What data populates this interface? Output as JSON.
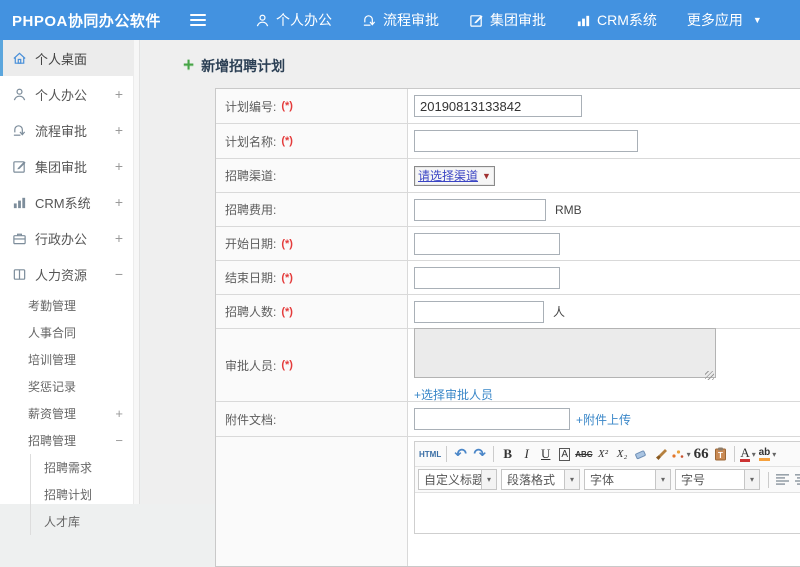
{
  "brand": "PHPOA协同办公软件",
  "icons": {
    "caret_down": "▼",
    "caret_small": "▾"
  },
  "topnav": {
    "items": [
      {
        "label": "个人办公"
      },
      {
        "label": "流程审批"
      },
      {
        "label": "集团审批"
      },
      {
        "label": "CRM系统"
      },
      {
        "label": "更多应用"
      }
    ]
  },
  "sidebar": {
    "items": [
      {
        "label": "个人桌面",
        "expand": ""
      },
      {
        "label": "个人办公",
        "expand": "+"
      },
      {
        "label": "流程审批",
        "expand": "+"
      },
      {
        "label": "集团审批",
        "expand": "+"
      },
      {
        "label": "CRM系统",
        "expand": "+"
      },
      {
        "label": "行政办公",
        "expand": "+"
      },
      {
        "label": "人力资源",
        "expand": "−"
      }
    ],
    "sub_items": [
      {
        "label": "考勤管理",
        "expand": ""
      },
      {
        "label": "人事合同",
        "expand": ""
      },
      {
        "label": "培训管理",
        "expand": ""
      },
      {
        "label": "奖惩记录",
        "expand": ""
      },
      {
        "label": "薪资管理",
        "expand": "+"
      },
      {
        "label": "招聘管理",
        "expand": "−"
      }
    ],
    "sub_sub_items": [
      {
        "label": "招聘需求"
      },
      {
        "label": "招聘计划"
      },
      {
        "label": "人才库"
      }
    ]
  },
  "page": {
    "title": "新增招聘计划"
  },
  "form": {
    "rows": [
      {
        "label": "计划编号:",
        "required": "(*)"
      },
      {
        "label": "计划名称:",
        "required": "(*)"
      },
      {
        "label": "招聘渠道:",
        "required": ""
      },
      {
        "label": "招聘费用:",
        "required": ""
      },
      {
        "label": "开始日期:",
        "required": "(*)"
      },
      {
        "label": "结束日期:",
        "required": "(*)"
      },
      {
        "label": "招聘人数:",
        "required": "(*)"
      },
      {
        "label": "审批人员:",
        "required": "(*)"
      },
      {
        "label": "附件文档:",
        "required": ""
      }
    ],
    "plan_no_value": "20190813133842",
    "channel_selected": "请选择渠道",
    "currency_suffix": "RMB",
    "people_suffix": "人",
    "approver_link": "+选择审批人员",
    "attach_link": "+附件上传"
  },
  "editor": {
    "buttons": {
      "html": "HTML",
      "undo": "↶",
      "redo": "↷",
      "bold": "B",
      "italic": "I",
      "underline": "U",
      "fontborder": "A",
      "strikethrough": "ABC",
      "superscript": "X²",
      "subscript": "X₂",
      "blockquote": "66",
      "forecolor": "A",
      "backcolor": "ab"
    },
    "dropdowns": [
      {
        "label": "自定义标题"
      },
      {
        "label": "段落格式"
      },
      {
        "label": "字体"
      },
      {
        "label": "字号"
      }
    ]
  }
}
